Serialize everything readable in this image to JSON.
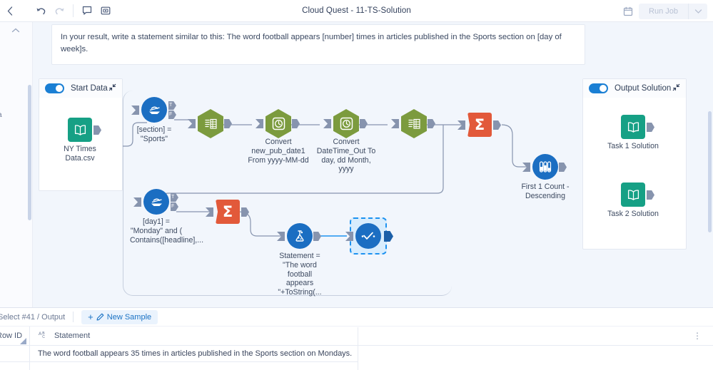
{
  "topbar": {
    "back_icon": "chevron-left-icon",
    "undo_icon": "undo-icon",
    "redo_icon": "redo-icon",
    "comment_icon": "comment-icon",
    "panel_icon": "panel-card-icon",
    "title": "Cloud Quest - 11-TS-Solution",
    "calendar_icon": "calendar-icon",
    "run_job_label": "Run Job",
    "run_job_caret": "chevron-down-icon"
  },
  "left_rail": {
    "collapse_caret": "chevron-up-icon",
    "clipped_text": "a"
  },
  "canvas": {
    "note": "In your result, write a statement similar to this: The word football appears [number] times in articles published in the Sports section on [day of week]s.",
    "start_container": {
      "title": "Start Data",
      "toggle_on": true,
      "collapse_icon": "collapse-arrows-icon",
      "node_label": "NY Times Data.csv",
      "node_icon": "book-input-icon"
    },
    "output_container": {
      "title": "Output Solution",
      "toggle_on": true,
      "collapse_icon": "collapse-arrows-icon",
      "nodes": [
        {
          "label": "Task 1 Solution",
          "icon": "book-input-icon"
        },
        {
          "label": "Task 2 Solution",
          "icon": "book-input-icon"
        }
      ]
    },
    "nodes": {
      "filter_section": {
        "label": "[section] = \"Sports\"",
        "icon": "filter-icon",
        "true_anchor": "T",
        "false_anchor": "F"
      },
      "select_1": {
        "label": "",
        "icon": "select-columns-icon"
      },
      "convert_from": {
        "label": "Convert new_pub_date1 From yyyy-MM-dd",
        "icon": "datetime-clock-icon"
      },
      "convert_to": {
        "label": "Convert DateTime_Out To day, dd Month, yyyy",
        "icon": "datetime-clock-icon"
      },
      "select_2": {
        "label": "",
        "icon": "select-columns-icon"
      },
      "summarize_1": {
        "label": "",
        "icon": "sigma-icon",
        "glyph": "Σ"
      },
      "sample_first": {
        "label": "First 1 Count - Descending",
        "icon": "sample-testtubes-icon"
      },
      "filter_day": {
        "label": "[day1] = \"Monday\" and ( Contains([headline],...",
        "icon": "filter-icon",
        "true_anchor": "T",
        "false_anchor": "F"
      },
      "summarize_2": {
        "label": "",
        "icon": "sigma-icon",
        "glyph": "Σ"
      },
      "formula": {
        "label": "Statement = \"The word football appears \"+ToString(...",
        "icon": "formula-flask-icon"
      },
      "browse_selected": {
        "label": "",
        "icon": "browse-check-icon",
        "selected": true
      }
    }
  },
  "bottom_panel": {
    "breadcrumb": "Select #41 / Output",
    "new_sample_label": "New Sample",
    "new_sample_icon": "plus-pencil-icon",
    "columns": [
      {
        "header": "Row ID",
        "type_icon": ""
      },
      {
        "header": "Statement",
        "type_icon": "abc-string-icon"
      }
    ],
    "kebab_icon": "kebab-menu-icon",
    "rows": [
      {
        "row_id": "",
        "statement": "The word football appears 35 times in articles published in the Sports section on Mondays."
      }
    ]
  },
  "colors": {
    "accent_blue": "#1b6ec2",
    "hex_green": "#7c9b3e",
    "summarize_orange": "#e2593a",
    "book_teal": "#16a085",
    "canvas_bg": "#f2f6fc",
    "selection_blue": "#1d92f0"
  }
}
